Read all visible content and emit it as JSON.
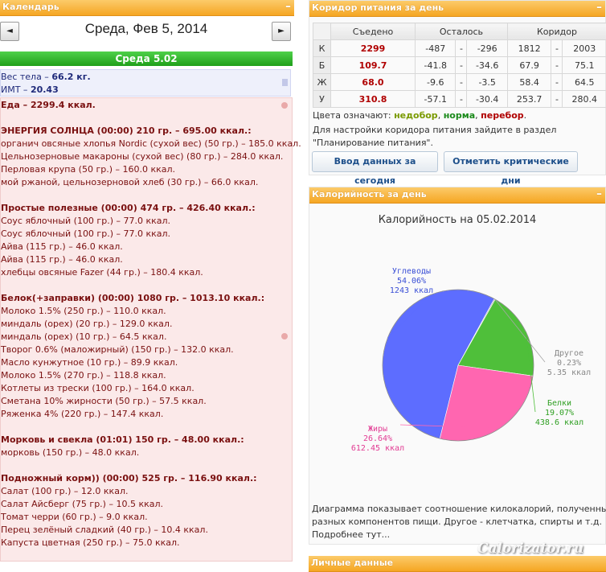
{
  "calendar": {
    "header": "Календарь",
    "prev_label": "◄",
    "next_label": "►",
    "day_title": "Среда, Фев 5, 2014",
    "day_bar": "Среда 5.02",
    "body": {
      "weight_label": "Вес тела – ",
      "weight_value": "66.2 кг.",
      "bmi_label": "ИМТ – ",
      "bmi_value": "20.43"
    },
    "food_lines": [
      {
        "text": "Еда – 2299.4 ккал.",
        "kind": "meal",
        "y": 0
      },
      {
        "text": "ЭНЕРГИЯ СОЛНЦА (00:00) 210 гр. – 695.00 ккал.:",
        "kind": "meal"
      },
      {
        "text": "органич овсяные хлопья Nordic (сухой вес) (50 гр.) – 185.0 ккал.",
        "kind": "item"
      },
      {
        "text": "Цельнозерновые макароны (сухой вес) (80 гр.) – 284.0 ккал.",
        "kind": "item"
      },
      {
        "text": "Перловая крупа (50 гр.) – 160.0 ккал.",
        "kind": "item"
      },
      {
        "text": "мой ржаной, цельнозерновой хлеб (30 гр.) – 66.0 ккал.",
        "kind": "item"
      },
      {
        "text": "Простые полезные (00:00) 474 гр. – 426.40 ккал.:",
        "kind": "meal"
      },
      {
        "text": "Соус яблочный (100 гр.) – 77.0 ккал.",
        "kind": "item"
      },
      {
        "text": "Соус яблочный (100 гр.) – 77.0 ккал.",
        "kind": "item"
      },
      {
        "text": "Айва (115 гр.) – 46.0 ккал.",
        "kind": "item"
      },
      {
        "text": "Айва (115 гр.) – 46.0 ккал.",
        "kind": "item"
      },
      {
        "text": "хлебцы овсяные Fazer (44 гр.) – 180.4 ккал.",
        "kind": "item"
      },
      {
        "text": "Белок(+заправки) (00:00) 1080 гр. – 1013.10 ккал.:",
        "kind": "meal"
      },
      {
        "text": "Молоко 1.5% (250 гр.) – 110.0 ккал.",
        "kind": "item"
      },
      {
        "text": "миндаль (орех) (20 гр.) – 129.0 ккал.",
        "kind": "item"
      },
      {
        "text": "миндаль (орех) (10 гр.) – 64.5 ккал.",
        "kind": "item"
      },
      {
        "text": "Творог 0.6% (маложирный) (150 гр.) – 132.0 ккал.",
        "kind": "item"
      },
      {
        "text": "Масло кунжутное (10 гр.) – 89.9 ккал.",
        "kind": "item"
      },
      {
        "text": "Молоко 1.5% (270 гр.) – 118.8 ккал.",
        "kind": "item"
      },
      {
        "text": "Котлеты из трески (100 гр.) – 164.0 ккал.",
        "kind": "item"
      },
      {
        "text": "Сметана 10% жирности (50 гр.) – 57.5 ккал.",
        "kind": "item"
      },
      {
        "text": "Ряженка 4% (220 гр.) – 147.4 ккал.",
        "kind": "item"
      },
      {
        "text": "Морковь и свекла (01:01) 150 гр. – 48.00 ккал.:",
        "kind": "meal"
      },
      {
        "text": "морковь (150 гр.) – 48.0 ккал.",
        "kind": "item"
      },
      {
        "text": "Подножный корм)) (00:00) 525 гр. – 116.90 ккал.:",
        "kind": "meal"
      },
      {
        "text": "Салат (100 гр.) – 12.0 ккал.",
        "kind": "item"
      },
      {
        "text": "Салат Айсберг (75 гр.) – 10.5 ккал.",
        "kind": "item"
      },
      {
        "text": "Томат черри (60 гр.) – 9.0 ккал.",
        "kind": "item"
      },
      {
        "text": "Перец зелёный сладкий (40 гр.) – 10.4 ккал.",
        "kind": "item"
      },
      {
        "text": "Капуста цветная (250 гр.) – 75.0 ккал.",
        "kind": "item"
      }
    ]
  },
  "corridor": {
    "header": "Коридор питания за день",
    "columns": [
      "Съедено",
      "Осталось",
      "Коридор"
    ],
    "rows": [
      {
        "label": "К",
        "eaten": "2299",
        "left_min": "-487",
        "left_max": "-296",
        "corr_min": "1812",
        "corr_max": "2003"
      },
      {
        "label": "Б",
        "eaten": "109.7",
        "left_min": "-41.8",
        "left_max": "-34.6",
        "corr_min": "67.9",
        "corr_max": "75.1"
      },
      {
        "label": "Ж",
        "eaten": "68.0",
        "left_min": "-9.6",
        "left_max": "-3.5",
        "corr_min": "58.4",
        "corr_max": "64.5"
      },
      {
        "label": "У",
        "eaten": "310.8",
        "left_min": "-57.1",
        "left_max": "-30.4",
        "corr_min": "253.7",
        "corr_max": "280.4"
      }
    ],
    "dash": "-",
    "legend_prefix": "Цвета означают: ",
    "legend_under": "недобор",
    "legend_norm": "норма",
    "legend_over": "перебор",
    "legend_sep": ", ",
    "legend_end": ".",
    "info_line1": "Для настройки коридора питания зайдите в раздел",
    "info_line2": "\"Планирование питания\".",
    "btn_today": "Ввод данных за сегодня",
    "btn_critical": "Отметить критические дни"
  },
  "calories": {
    "header": "Калорийность за день",
    "chart_data": {
      "type": "pie",
      "title": "Калорийность на 05.02.2014",
      "slices": [
        {
          "name": "Углеводы",
          "percent": "54.06%",
          "value": 1243,
          "value_label": "1243 ккал",
          "color": "#5d6dff"
        },
        {
          "name": "Другое",
          "percent": "0.23%",
          "value": 5.35,
          "value_label": "5.35 ккал",
          "color": "#a6a6a6"
        },
        {
          "name": "Белки",
          "percent": "19.07%",
          "value": 438.6,
          "value_label": "438.6 ккал",
          "color": "#4fbf3a"
        },
        {
          "name": "Жиры",
          "percent": "26.64%",
          "value": 612.45,
          "value_label": "612.45 ккал",
          "color": "#ff66b0"
        }
      ]
    },
    "desc_line1": "Диаграмма показывает соотношение килокалорий, полученных из",
    "desc_line2": "разных компонентов пищи. Другое - клетчатка, спирты и т.д.",
    "desc_line3": "Подробнее тут..."
  },
  "personal": {
    "header": "Личные данные"
  },
  "watermark": "Calorizator.ru",
  "colors": {
    "header_orange": "#f5a623",
    "day_bar_green": "#2fb52a",
    "food_red": "#7a1010",
    "eaten_red": "#b00000"
  }
}
